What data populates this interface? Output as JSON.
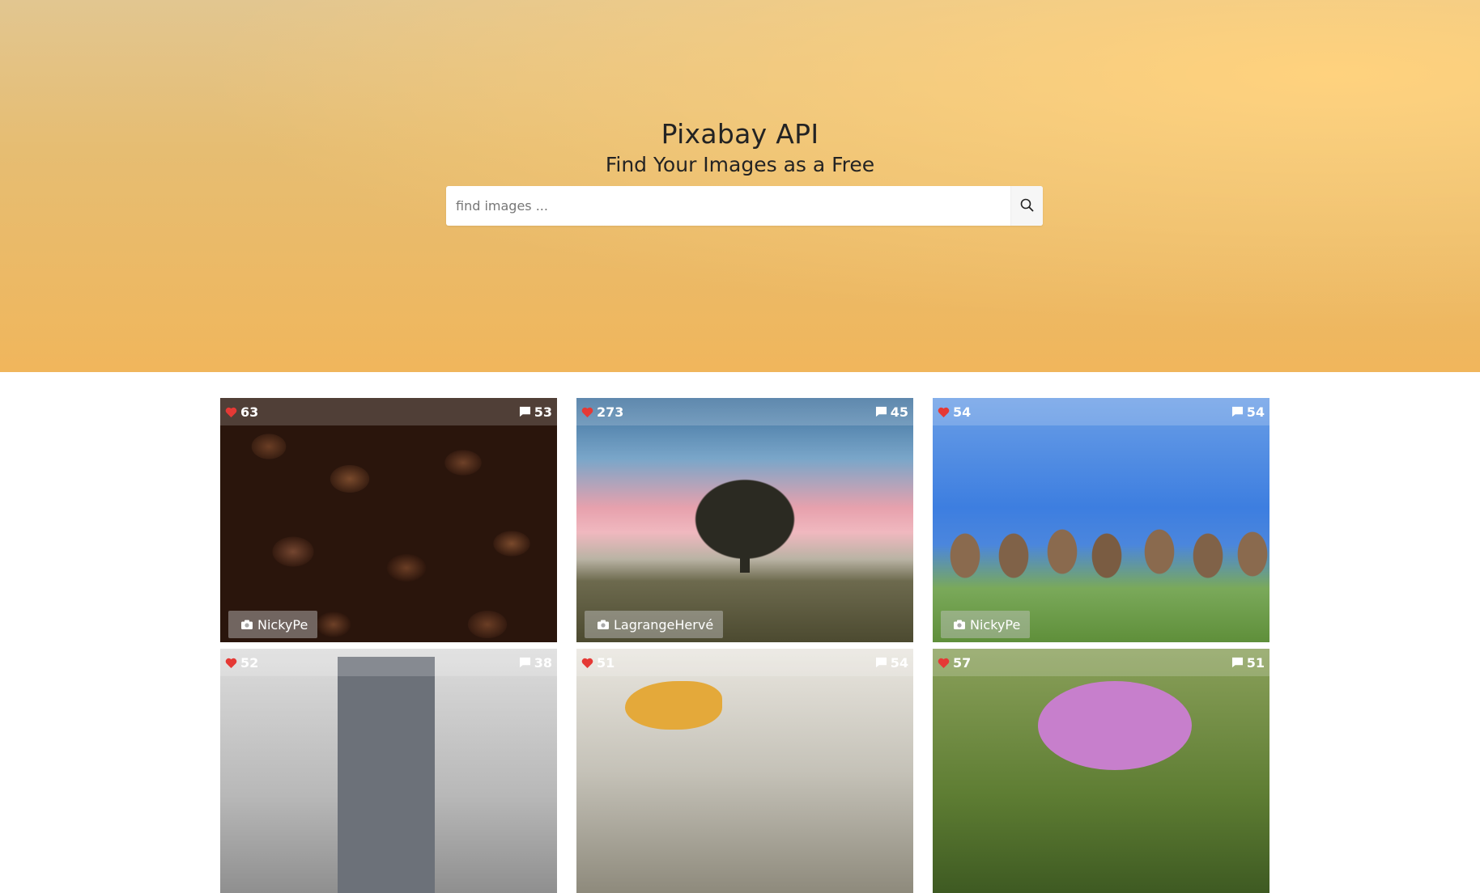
{
  "hero": {
    "title": "Pixabay API",
    "subtitle": "Find Your Images as a Free"
  },
  "search": {
    "placeholder": "find images ...",
    "value": "",
    "button_icon": "search-icon"
  },
  "colors": {
    "heart": "#e53935",
    "hero_top": "#e2c690",
    "hero_bottom": "#f0b65c"
  },
  "cards": [
    {
      "likes": "63",
      "comments": "53",
      "author": "NickyPe"
    },
    {
      "likes": "273",
      "comments": "45",
      "author": "LagrangeHervé"
    },
    {
      "likes": "54",
      "comments": "54",
      "author": "NickyPe"
    },
    {
      "likes": "52",
      "comments": "38"
    },
    {
      "likes": "51",
      "comments": "54"
    },
    {
      "likes": "57",
      "comments": "51"
    }
  ]
}
